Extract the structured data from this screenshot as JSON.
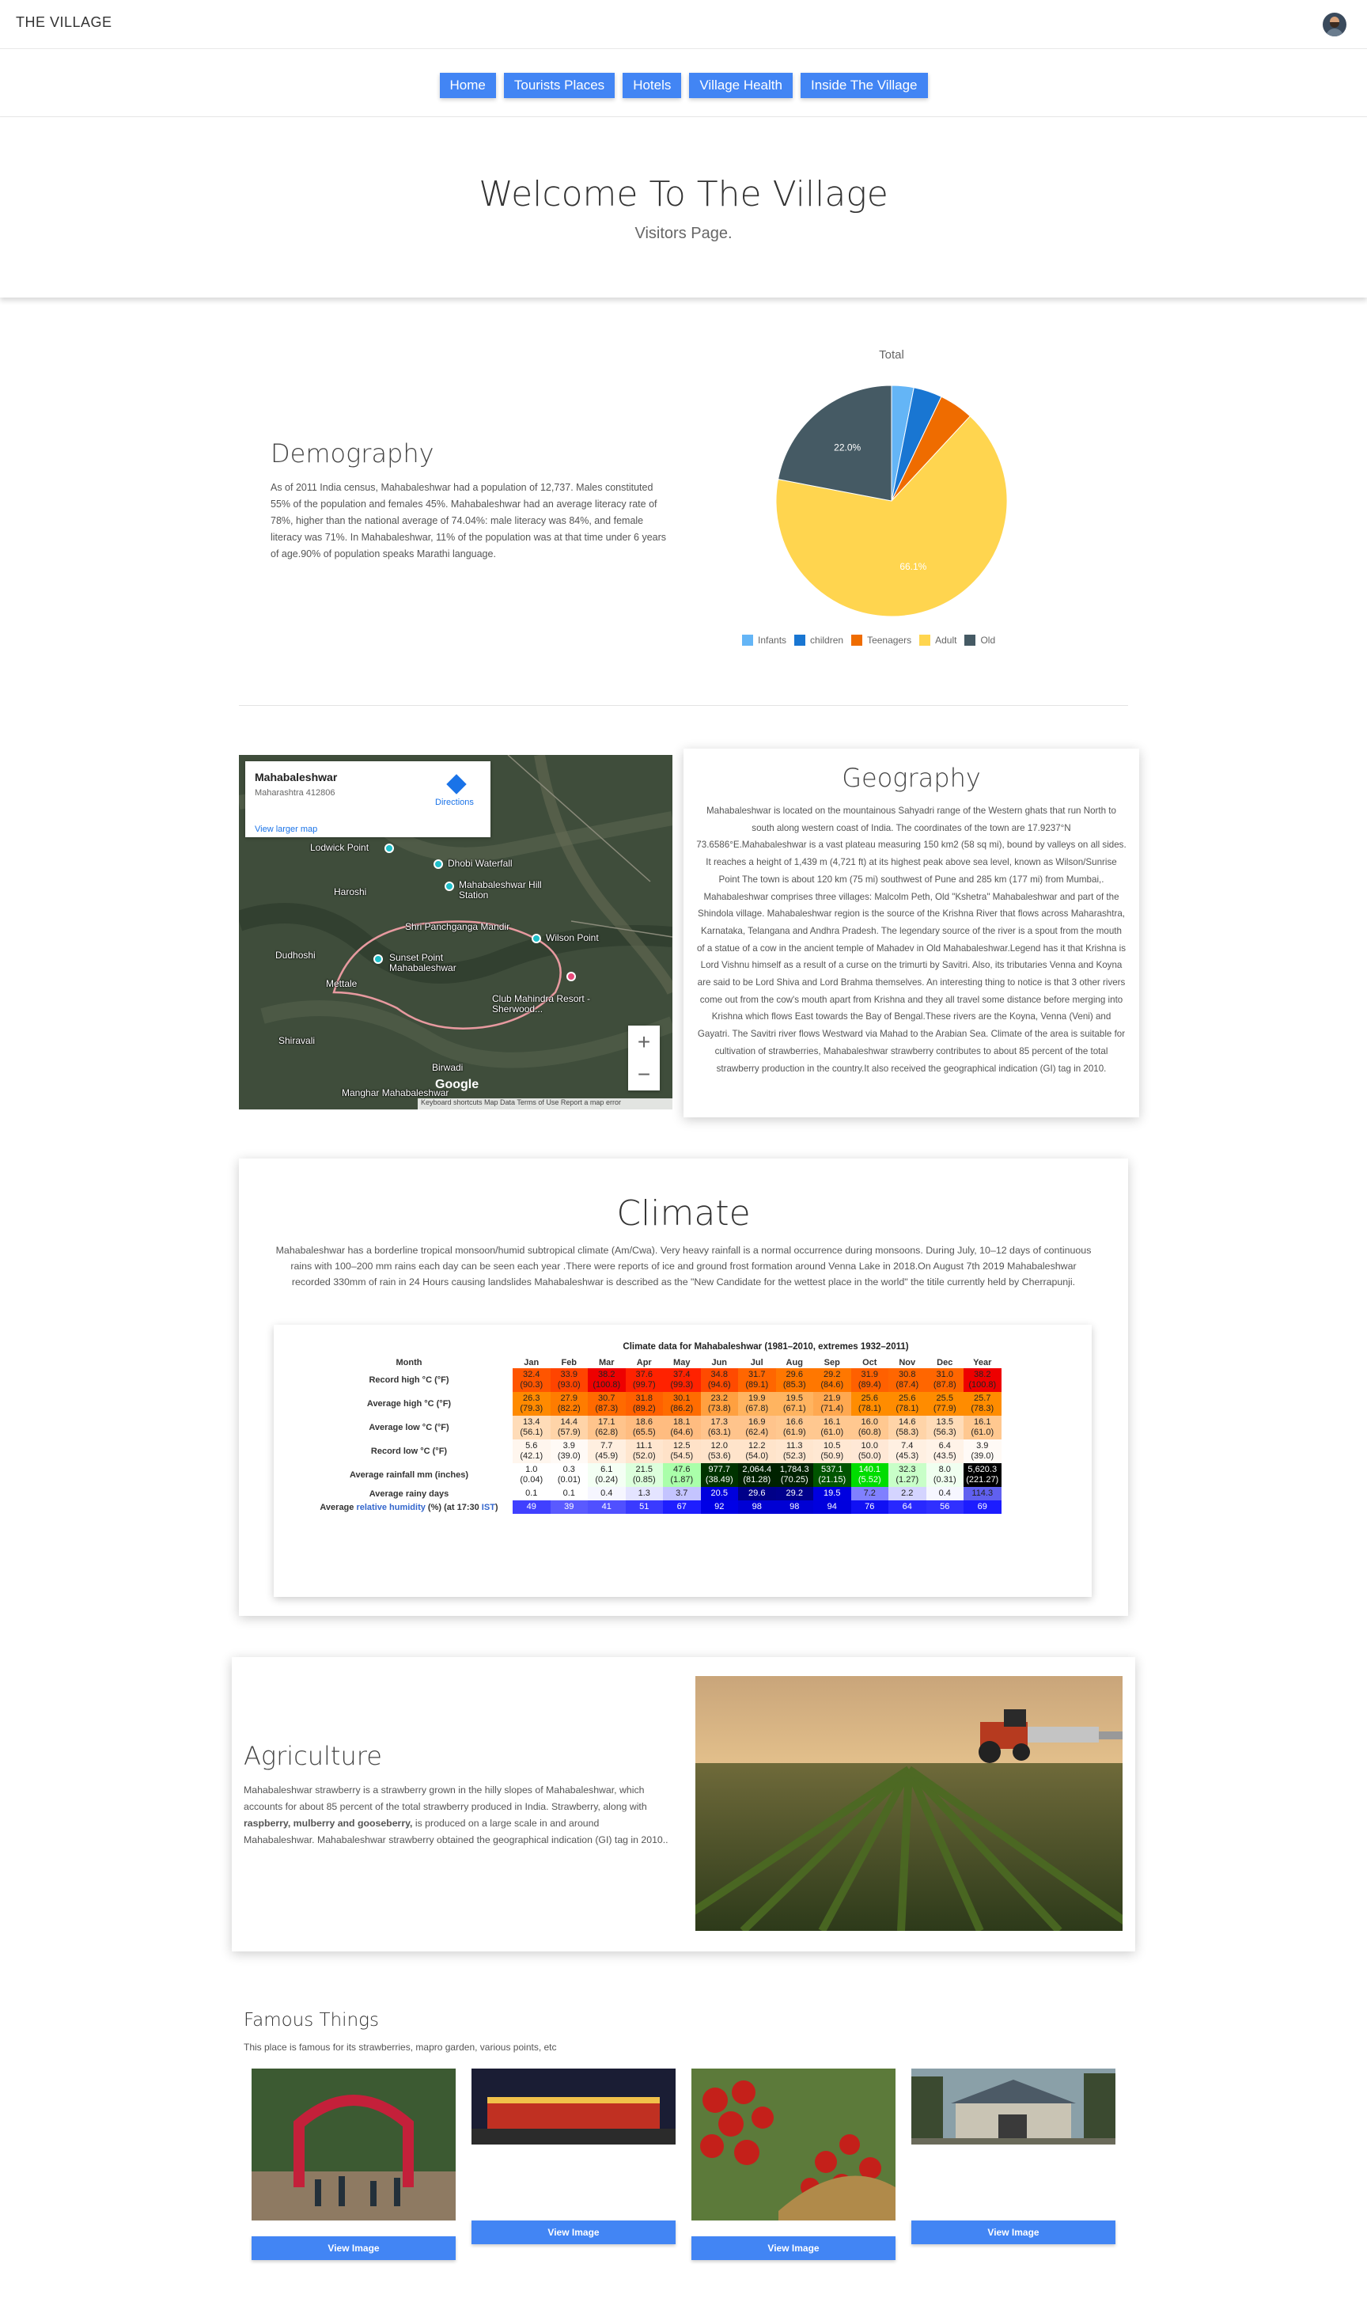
{
  "header": {
    "brand": "THE VILLAGE"
  },
  "nav": [
    "Home",
    "Tourists Places",
    "Hotels",
    "Village Health",
    "Inside The Village"
  ],
  "hero": {
    "title": "Welcome To The Village",
    "subtitle": "Visitors Page."
  },
  "demography": {
    "title": "Demography",
    "text": "As of 2011 India census, Mahabaleshwar had a population of 12,737. Males constituted 55% of the population and females 45%. Mahabaleshwar had an average literacy rate of 78%, higher than the national average of 74.04%: male literacy was 84%, and female literacy was 71%. In Mahabaleshwar, 11% of the population was at that time under 6 years of age.90% of population speaks Marathi language."
  },
  "chart_data": {
    "type": "pie",
    "title": "Total",
    "labels": [
      "Infants",
      "children",
      "Teenagers",
      "Adult",
      "Old"
    ],
    "values": [
      3.1,
      4.0,
      4.8,
      66.1,
      22.0
    ],
    "colors": [
      "#64b5f6",
      "#1976d2",
      "#ef6c00",
      "#ffd54f",
      "#455a64"
    ],
    "data_labels": [
      "",
      "",
      "",
      "66.1%",
      "22.0%"
    ],
    "legend_position": "bottom"
  },
  "map": {
    "place": "Mahabaleshwar",
    "address": "Maharashtra 412806",
    "directions": "Directions",
    "larger_map": "View larger map",
    "labels": [
      "Lodwick Point",
      "Dhobi Waterfall",
      "Mahabaleshwar Hill Station",
      "Haroshi",
      "Shri Panchganga Mandir",
      "Wilson Point",
      "Dudhoshi",
      "Sunset Point Mahabaleshwar",
      "Mettale",
      "Club Mahindra Resort - Sherwood...",
      "Shiravali",
      "Birwadi",
      "Manghar Mahabaleshwar"
    ],
    "zoom_in": "+",
    "zoom_out": "−",
    "google": "Google",
    "footer": "Keyboard shortcuts   Map Data   Terms of Use   Report a map error"
  },
  "geography": {
    "title": "Geography",
    "text": "Mahabaleshwar is located on the mountainous Sahyadri range of the Western ghats that run North to south along western coast of India. The coordinates of the town are 17.9237°N 73.6586°E.Mahabaleshwar is a vast plateau measuring 150 km2 (58 sq mi), bound by valleys on all sides. It reaches a height of 1,439 m (4,721 ft) at its highest peak above sea level, known as Wilson/Sunrise Point The town is about 120 km (75 mi) southwest of Pune and 285 km (177 mi) from Mumbai,. Mahabaleshwar comprises three villages: Malcolm Peth, Old \"Kshetra\" Mahabaleshwar and part of the Shindola village. Mahabaleshwar region is the source of the Krishna River that flows across Maharashtra, Karnataka, Telangana and Andhra Pradesh. The legendary source of the river is a spout from the mouth of a statue of a cow in the ancient temple of Mahadev in Old Mahabaleshwar.Legend has it that Krishna is Lord Vishnu himself as a result of a curse on the trimurti by Savitri. Also, its tributaries Venna and Koyna are said to be Lord Shiva and Lord Brahma themselves. An interesting thing to notice is that 3 other rivers come out from the cow's mouth apart from Krishna and they all travel some distance before merging into Krishna which flows East towards the Bay of Bengal.These rivers are the Koyna, Venna (Veni) and Gayatri. The Savitri river flows Westward via Mahad to the Arabian Sea. Climate of the area is suitable for cultivation of strawberries, Mahabaleshwar strawberry contributes to about 85 percent of the total strawberry production in the country.It also received the geographical indication (GI) tag in 2010."
  },
  "climate": {
    "title": "Climate",
    "text": "Mahabaleshwar has a borderline tropical monsoon/humid subtropical climate (Am/Cwa). Very heavy rainfall is a normal occurrence during monsoons. During July, 10–12 days of continuous rains with 100–200 mm rains each day can be seen each year .There were reports of ice and ground frost formation around Venna Lake in 2018.On August 7th 2019 Mahabaleshwar recorded 330mm of rain in 24 Hours causing landslides Mahabaleshwar is described as the \"New Candidate for the wettest place in the world\" the titile currently held by Cherrapunji.",
    "table": {
      "caption": "Climate data for Mahabaleshwar (1981–2010, extremes 1932–2011)",
      "month_header": "Month",
      "months": [
        "Jan",
        "Feb",
        "Mar",
        "Apr",
        "May",
        "Jun",
        "Jul",
        "Aug",
        "Sep",
        "Oct",
        "Nov",
        "Dec",
        "Year"
      ],
      "rows": [
        {
          "label": "Record high °C (°F)",
          "cells": [
            "32.4 (90.3)",
            "33.9 (93.0)",
            "38.2 (100.8)",
            "37.6 (99.7)",
            "37.4 (99.3)",
            "34.8 (94.6)",
            "31.7 (89.1)",
            "29.6 (85.3)",
            "29.2 (84.6)",
            "31.9 (89.4)",
            "30.8 (87.4)",
            "31.0 (87.8)",
            "38.2 (100.8)"
          ],
          "colors": [
            "#ff5500",
            "#ff4400",
            "#ee0000",
            "#ff2200",
            "#ff2200",
            "#ff4a00",
            "#ff6600",
            "#ff7700",
            "#ff7700",
            "#ff6000",
            "#ff6600",
            "#ff6600",
            "#ee0000"
          ]
        },
        {
          "label": "Average high °C (°F)",
          "cells": [
            "26.3 (79.3)",
            "27.9 (82.2)",
            "30.7 (87.3)",
            "31.8 (89.2)",
            "30.1 (86.2)",
            "23.2 (73.8)",
            "19.9 (67.8)",
            "19.5 (67.1)",
            "21.9 (71.4)",
            "25.6 (78.1)",
            "25.6 (78.1)",
            "25.5 (77.9)",
            "25.7 (78.3)"
          ],
          "colors": [
            "#ff8a00",
            "#ff7c00",
            "#ff6a00",
            "#ff6000",
            "#ff6c00",
            "#ffa040",
            "#ffb460",
            "#ffb460",
            "#ffa850",
            "#ff8c00",
            "#ff8c00",
            "#ff8c00",
            "#ff8c00"
          ]
        },
        {
          "label": "Average low °C (°F)",
          "cells": [
            "13.4 (56.1)",
            "14.4 (57.9)",
            "17.1 (62.8)",
            "18.6 (65.5)",
            "18.1 (64.6)",
            "17.3 (63.1)",
            "16.9 (62.4)",
            "16.6 (61.9)",
            "16.1 (61.0)",
            "16.0 (60.8)",
            "14.6 (58.3)",
            "13.5 (56.3)",
            "16.1 (61.0)"
          ],
          "colors": [
            "#ffdcb8",
            "#ffd4a8",
            "#ffc48c",
            "#ffbc80",
            "#ffbc80",
            "#ffc48c",
            "#ffc48c",
            "#ffc890",
            "#ffc890",
            "#ffc890",
            "#ffd4a8",
            "#ffdcb8",
            "#ffc890"
          ]
        },
        {
          "label": "Record low °C (°F)",
          "cells": [
            "5.6 (42.1)",
            "3.9 (39.0)",
            "7.7 (45.9)",
            "11.1 (52.0)",
            "12.5 (54.5)",
            "12.0 (53.6)",
            "12.2 (54.0)",
            "11.3 (52.3)",
            "10.5 (50.9)",
            "10.0 (50.0)",
            "7.4 (45.3)",
            "6.4 (43.5)",
            "3.9 (39.0)"
          ],
          "colors": [
            "#fff6ee",
            "#fffaf6",
            "#ffefe0",
            "#ffe6cf",
            "#ffe2c8",
            "#ffe4cb",
            "#ffe4cb",
            "#ffe6cf",
            "#ffe8d3",
            "#ffe8d6",
            "#fff0e2",
            "#fff3e8",
            "#fffaf6"
          ]
        },
        {
          "label": "Average rainfall mm (inches)",
          "cells": [
            "1.0 (0.04)",
            "0.3 (0.01)",
            "6.1 (0.24)",
            "21.5 (0.85)",
            "47.6 (1.87)",
            "977.7 (38.49)",
            "2,064.4 (81.28)",
            "1,784.3 (70.25)",
            "537.1 (21.15)",
            "140.1 (5.52)",
            "32.3 (1.27)",
            "8.0 (0.31)",
            "5,620.3 (221.27)"
          ],
          "colors": [
            "#ffffff",
            "#ffffff",
            "#f4fff4",
            "#dcffdc",
            "#aaffaa",
            "#003300",
            "#002200",
            "#002200",
            "#005500",
            "#00dd00",
            "#c8ffc8",
            "#f0fff0",
            "#000000"
          ],
          "text_colors": [
            "#222",
            "#222",
            "#222",
            "#222",
            "#222",
            "#fff",
            "#fff",
            "#fff",
            "#fff",
            "#fff",
            "#222",
            "#222",
            "#fff"
          ]
        },
        {
          "label": "Average rainy days",
          "cells": [
            "0.1",
            "0.1",
            "0.4",
            "1.3",
            "3.7",
            "20.5",
            "29.6",
            "29.2",
            "19.5",
            "7.2",
            "2.2",
            "0.4",
            "114.3"
          ],
          "colors": [
            "#ffffff",
            "#ffffff",
            "#f6f6ff",
            "#e4e4ff",
            "#c4c4ff",
            "#0000dd",
            "#000088",
            "#00008c",
            "#0000e0",
            "#8080ff",
            "#d4d4ff",
            "#f6f6ff",
            "#6060f0"
          ],
          "text_colors": [
            "#222",
            "#222",
            "#222",
            "#222",
            "#222",
            "#fff",
            "#fff",
            "#fff",
            "#fff",
            "#222",
            "#222",
            "#222",
            "#222"
          ]
        },
        {
          "label_prefix": "Average ",
          "label_link": "relative humidity",
          "label_suffix": " (%) (at 17:30 ",
          "label_link2": "IST",
          "label_end": ")",
          "cells": [
            "49",
            "39",
            "41",
            "51",
            "67",
            "92",
            "98",
            "98",
            "94",
            "76",
            "64",
            "56",
            "69"
          ],
          "colors": [
            "#4040ff",
            "#5a5aff",
            "#5050ff",
            "#3a3aff",
            "#1e1eff",
            "#0000e6",
            "#0000d4",
            "#0000d4",
            "#0000de",
            "#1010f4",
            "#2828ff",
            "#3030ff",
            "#1c1cff"
          ],
          "text_colors": [
            "#fff",
            "#fff",
            "#fff",
            "#fff",
            "#fff",
            "#fff",
            "#fff",
            "#fff",
            "#fff",
            "#fff",
            "#fff",
            "#fff",
            "#fff"
          ]
        }
      ]
    }
  },
  "agriculture": {
    "title": "Agriculture",
    "text_1": "Mahabaleshwar strawberry is a strawberry grown in the hilly slopes of Mahabaleshwar, which accounts for about 85 percent of the total strawberry produced in India. Strawberry, along with ",
    "text_bold": "raspberry, mulberry and gooseberry,",
    "text_2": " is produced on a large scale in and around Mahabaleshwar. Mahabaleshwar strawberry obtained the geographical indication (GI) tag in 2010.."
  },
  "famous": {
    "title": "Famous Things",
    "subtitle": "This place is famous for its strawberries, mapro garden, various points, etc",
    "items": [
      {
        "button": "View Image"
      },
      {
        "button": "View Image"
      },
      {
        "button": "View Image"
      },
      {
        "button": "View Image"
      }
    ]
  }
}
